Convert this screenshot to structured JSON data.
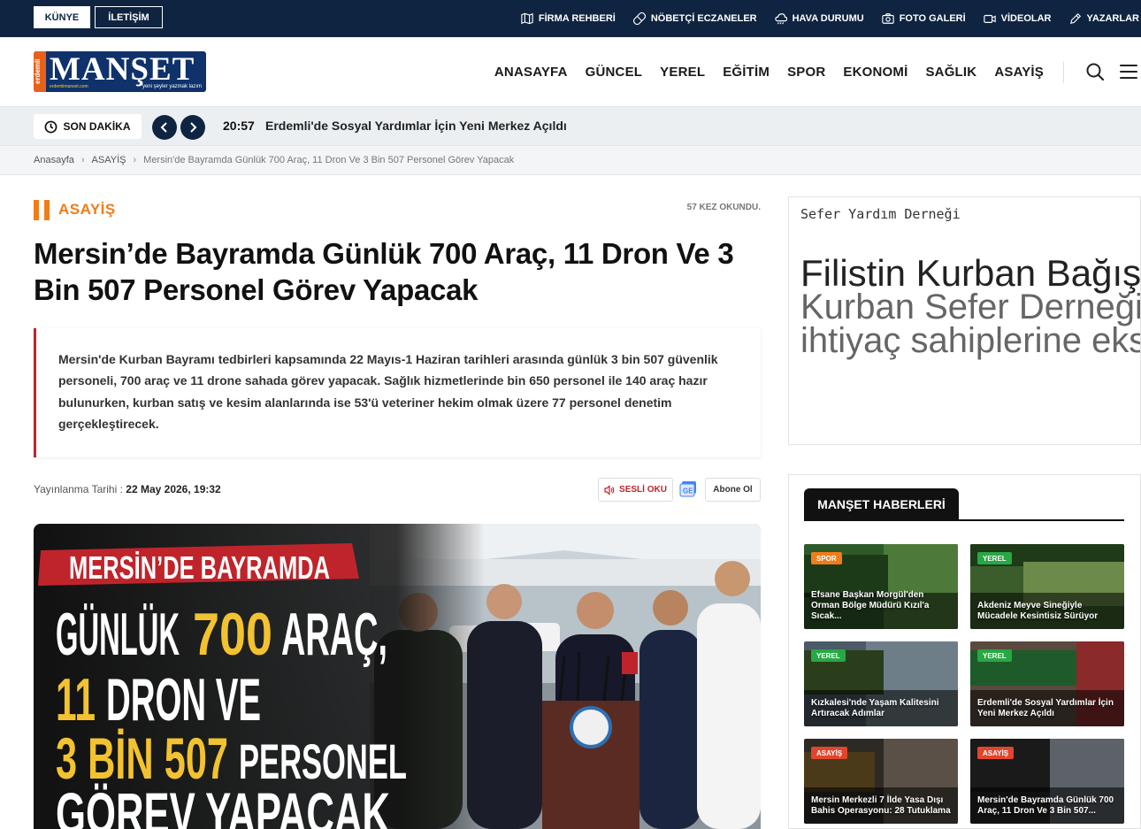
{
  "topbar": {
    "kunye": "KÜNYE",
    "iletisim": "İLETİŞİM",
    "links": [
      {
        "label": "FİRMA REHBERİ",
        "icon": "map-icon"
      },
      {
        "label": "NÖBETÇİ ECZANELER",
        "icon": "pharmacy-icon"
      },
      {
        "label": "HAVA DURUMU",
        "icon": "weather-icon"
      },
      {
        "label": "FOTO GALERİ",
        "icon": "camera-icon"
      },
      {
        "label": "VİDEOLAR",
        "icon": "video-icon"
      },
      {
        "label": "YAZARLAR",
        "icon": "pen-icon"
      }
    ]
  },
  "logo": {
    "brand": "MANŞET",
    "prefix": "erdemli",
    "slogan": "yeni şeyler yazmak lazım",
    "site": "erdemlimanset.com"
  },
  "nav": {
    "items": [
      "ANASAYFA",
      "GÜNCEL",
      "YEREL",
      "EĞİTİM",
      "SPOR",
      "EKONOMİ",
      "SAĞLIK",
      "ASAYİŞ"
    ]
  },
  "breaking": {
    "label": "SON DAKİKA",
    "time": "20:57",
    "text": "Erdemli'de Sosyal Yardımlar İçin Yeni Merkez Açıldı"
  },
  "breadcrumb": {
    "home": "Anasayfa",
    "category": "ASAYİŞ",
    "current": "Mersin'de Bayramda Günlük 700 Araç, 11 Dron Ve 3 Bin 507 Personel Görev Yapacak"
  },
  "article": {
    "category": "ASAYİŞ",
    "read_count": "57 KEZ OKUNDU.",
    "title": "Mersin’de Bayramda Günlük 700 Araç, 11 Dron Ve 3 Bin 507 Personel Görev Yapacak",
    "summary": "Mersin'de Kurban Bayramı tedbirleri kapsamında 22 Mayıs-1 Haziran tarihleri arasında günlük 3 bin 507 güvenlik personeli, 700 araç ve 11 drone sahada görev yapacak. Sağlık hizmetlerinde bin 650 personel ile 140 araç hazır bulunurken, kurban satış ve kesim alanlarında ise 53'ü veteriner hekim olmak üzere 77 personel denetim gerçekleştirecek.",
    "pub_label": "Yayınlanma Tarihi :",
    "pub_date": "22 May 2026, 19:32",
    "sesli_oku": "SESLİ OKU",
    "abone": "Abone Ol",
    "hero_image": "press-conference-image"
  },
  "sidebar": {
    "ad": {
      "small": "Sefer Yardım Derneği",
      "big": "Filistin Kurban Bağışı",
      "line2": "Kurban Sefer Derneği",
      "line3": "ihtiyaç sahiplerine eksiksiz"
    },
    "headlines_title": "MANŞET HABERLERİ",
    "cards": [
      {
        "badge": "SPOR",
        "badge_color": "#f07d1a",
        "caption": "Efsane Başkan Morgül'den Orman Bölge Müdürü Kızıl'a Sıcak..."
      },
      {
        "badge": "YEREL",
        "badge_color": "#27a844",
        "caption": "Akdeniz Meyve Sineğiyle Mücadele Kesintisiz Sürüyor"
      },
      {
        "badge": "YEREL",
        "badge_color": "#27a844",
        "caption": "Kızkalesi'nde Yaşam Kalitesini Artıracak Adımlar"
      },
      {
        "badge": "YEREL",
        "badge_color": "#27a844",
        "caption": "Erdemli'de Sosyal Yardımlar İçin Yeni Merkez Açıldı"
      },
      {
        "badge": "ASAYİŞ",
        "badge_color": "#e2452b",
        "caption": "Mersin Merkezli 7 İlde Yasa Dışı Bahis Operasyonu: 28 Tutuklama"
      },
      {
        "badge": "ASAYİŞ",
        "badge_color": "#e2452b",
        "caption": "Mersin'de Bayramda Günlük 700 Araç, 11 Dron Ve 3 Bin 507..."
      }
    ]
  },
  "colors": {
    "navy": "#0f2440",
    "accent_orange": "#f07d1a",
    "accent_red": "#c0242b"
  }
}
